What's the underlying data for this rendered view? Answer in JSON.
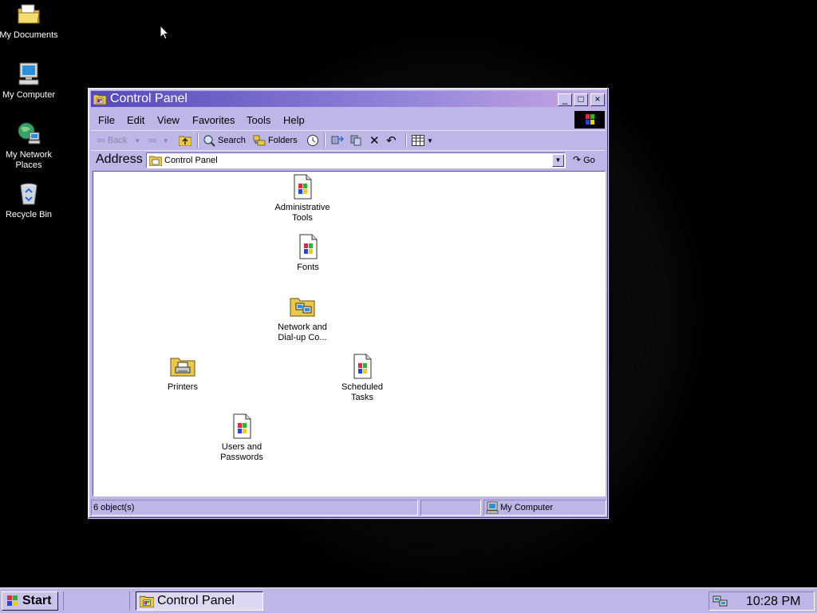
{
  "desktop": {
    "icons": [
      {
        "label": "My Documents",
        "icon": "folder-documents-icon"
      },
      {
        "label": "My Computer",
        "icon": "computer-icon"
      },
      {
        "label": "My Network Places",
        "icon": "network-globe-icon"
      },
      {
        "label": "Recycle Bin",
        "icon": "recycle-bin-icon"
      }
    ]
  },
  "window": {
    "title": "Control Panel",
    "controls": {
      "minimize": "_",
      "maximize": "□",
      "close": "×"
    },
    "menu": [
      "File",
      "Edit",
      "View",
      "Favorites",
      "Tools",
      "Help"
    ],
    "toolbar": {
      "back": "Back",
      "search": "Search",
      "folders": "Folders"
    },
    "address": {
      "label": "Address",
      "value": "Control Panel",
      "go": "Go"
    },
    "items": [
      {
        "label": "Administrative Tools",
        "icon": "document-app-icon"
      },
      {
        "label": "Fonts",
        "icon": "document-app-icon"
      },
      {
        "label": "Network and Dial-up Co...",
        "icon": "network-folder-icon"
      },
      {
        "label": "Printers",
        "icon": "printer-folder-icon"
      },
      {
        "label": "Scheduled Tasks",
        "icon": "document-app-icon"
      },
      {
        "label": "Users and Passwords",
        "icon": "document-app-icon"
      }
    ],
    "status": {
      "objects": "6 object(s)",
      "zone": "My Computer"
    }
  },
  "taskbar": {
    "start": "Start",
    "task": "Control Panel",
    "clock": "10:28 PM"
  },
  "colors": {
    "window_frame": "#bdb6e6",
    "title_gradient_start": "#5648b8",
    "title_gradient_end": "#c7a7e2",
    "desktop": "#000000"
  }
}
